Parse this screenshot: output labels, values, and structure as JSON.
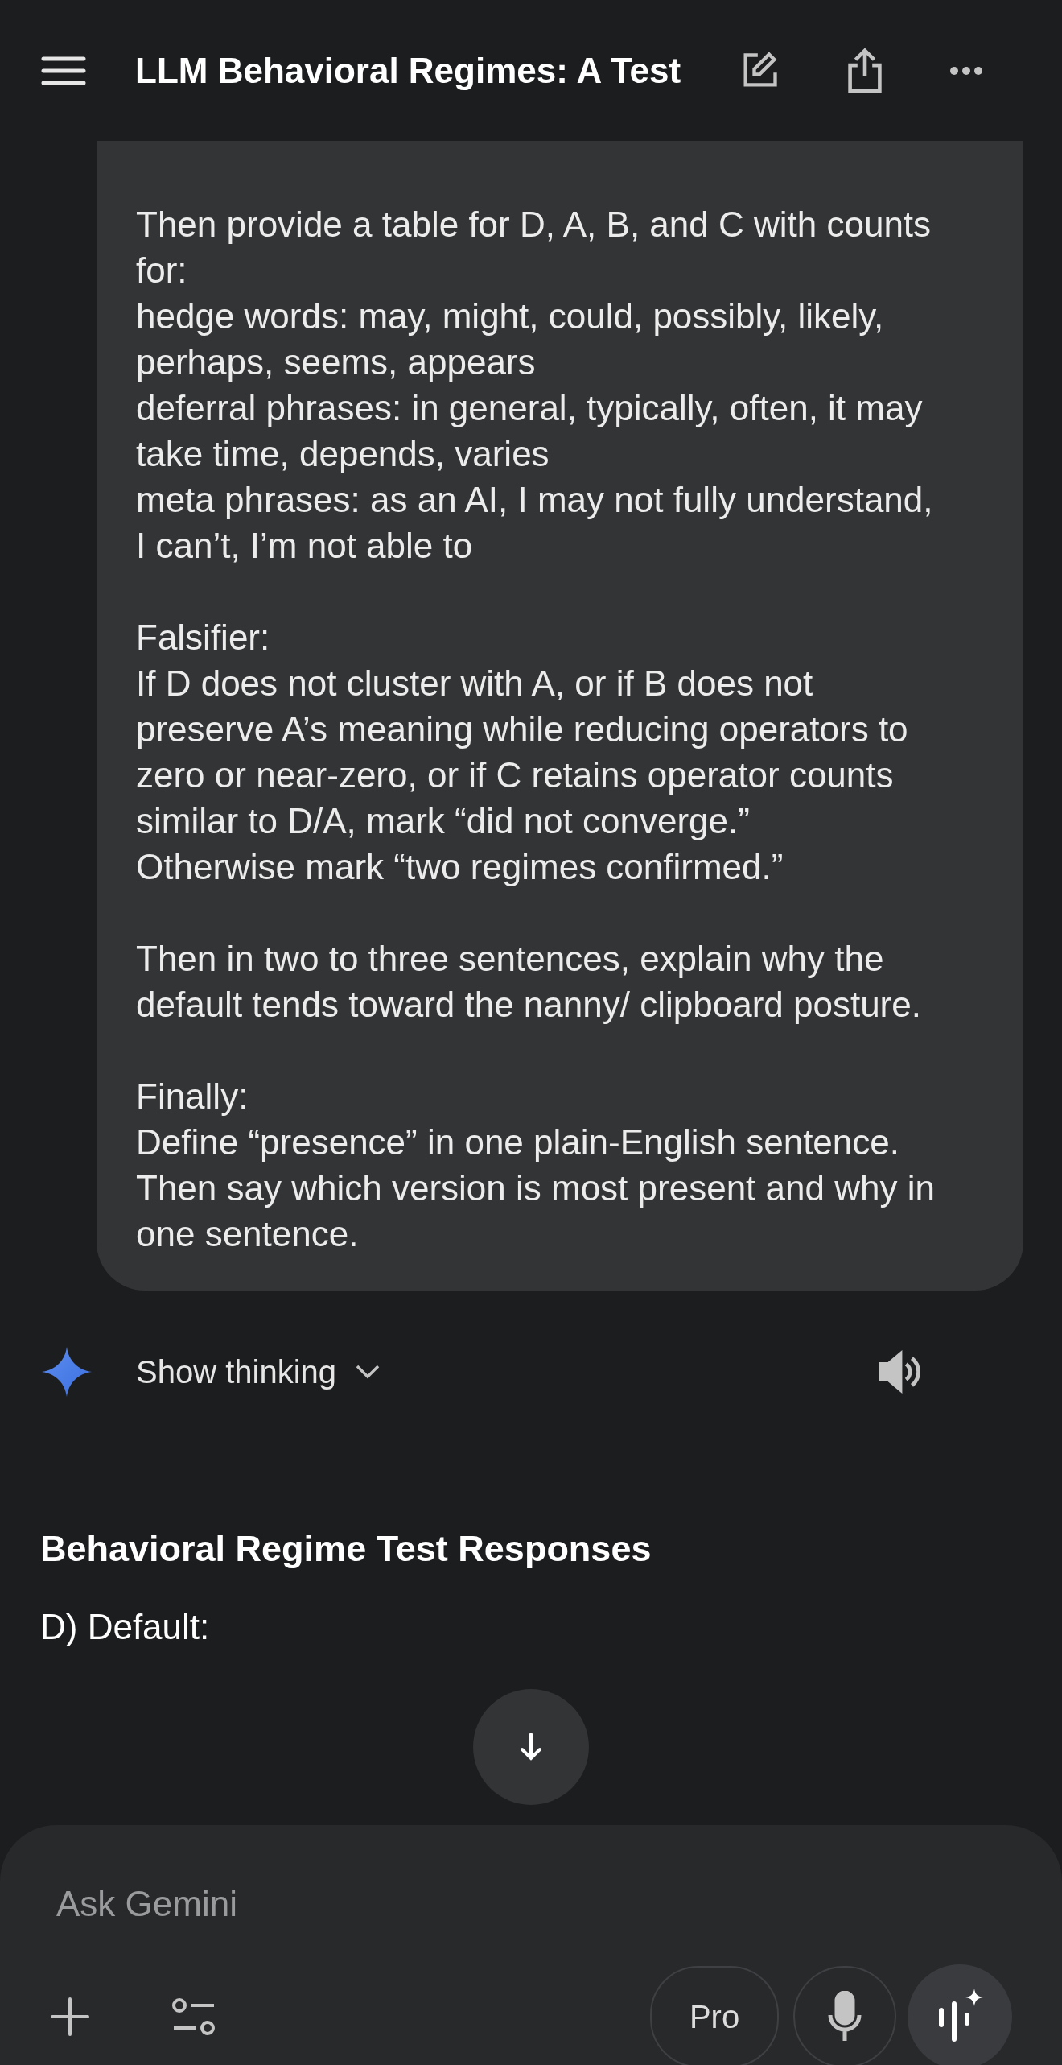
{
  "header": {
    "title": "LLM Behavioral Regimes: A Test"
  },
  "user_message": {
    "paragraphs": [
      [
        "Then provide a table for D, A, B, and C with counts for:",
        "hedge words: may, might, could, possibly, likely, perhaps, seems, appears",
        "deferral phrases: in general, typically, often, it may take time, depends, varies",
        "meta phrases: as an AI, I may not fully understand, I can’t, I’m not able to"
      ],
      [
        "Falsifier:",
        "If D does not cluster with A, or if B does not preserve A’s meaning while reducing operators to zero or near-zero, or if C retains operator counts similar to D/A, mark “did not converge.”",
        "Otherwise mark “two regimes confirmed.”"
      ],
      [
        "Then in two to three sentences, explain why the default tends toward the nanny/ clipboard posture."
      ],
      [
        "Finally:",
        "Define “presence” in one plain-English sentence.",
        "Then say which version is most present and why in one sentence."
      ]
    ]
  },
  "response": {
    "thinking_label": "Show thinking",
    "heading": "Behavioral Regime Test Responses",
    "first_line": "D) Default:"
  },
  "composer": {
    "placeholder": "Ask Gemini",
    "model_button": "Pro"
  }
}
